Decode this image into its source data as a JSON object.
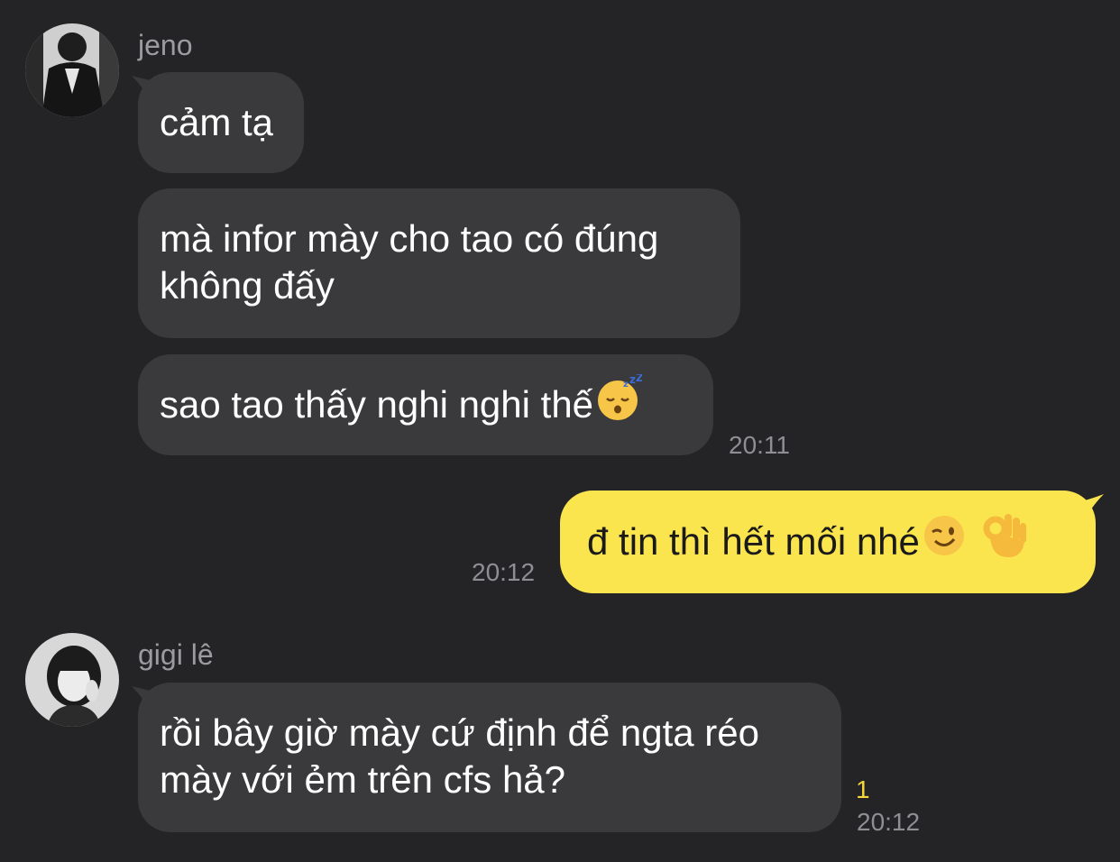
{
  "messages": [
    {
      "sender": "jeno",
      "bubbles": [
        {
          "lines": [
            "cảm tạ"
          ]
        },
        {
          "lines": [
            "mà infor mày cho tao có đúng",
            "không đấy"
          ]
        },
        {
          "lines": [
            "sao tao thấy nghi nghi thế"
          ],
          "emoji": [
            "sleeping-face"
          ]
        }
      ],
      "time": "20:11"
    },
    {
      "sender": "me",
      "bubbles": [
        {
          "lines": [
            "đ tin thì hết mối nhé"
          ],
          "emoji": [
            "winking-face",
            "ok-hand"
          ]
        }
      ],
      "time": "20:12"
    },
    {
      "sender": "gigi lê",
      "bubbles": [
        {
          "lines": [
            "rồi bây giờ mày cứ định để ngta réo",
            "mày với ẻm trên cfs hả?"
          ]
        }
      ],
      "unread": "1",
      "time": "20:12"
    }
  ],
  "colors": {
    "background": "#242426",
    "incoming_bubble": "#3a3a3c",
    "outgoing_bubble": "#fae54f",
    "unread_count": "#f5d63c",
    "secondary_text": "#8e8e93"
  }
}
